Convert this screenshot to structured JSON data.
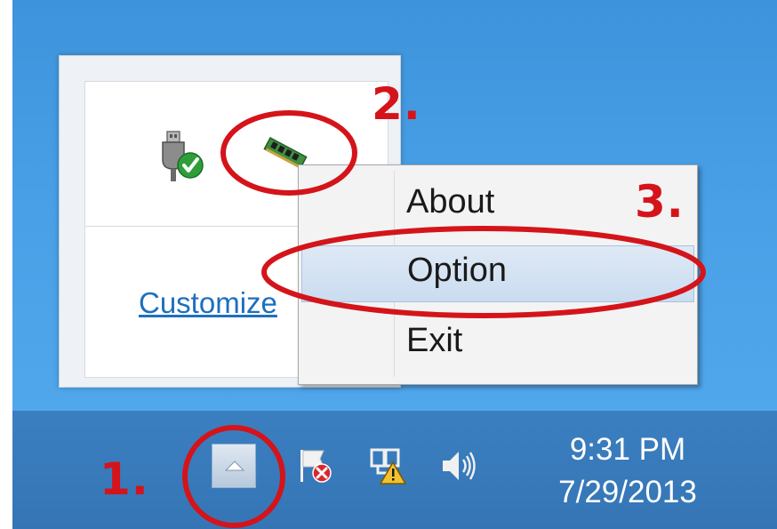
{
  "tray_overflow": {
    "icons": [
      "usb-device-icon",
      "memory-module-icon"
    ],
    "customize_link": "Customize"
  },
  "context_menu": {
    "items": [
      {
        "label": "About"
      },
      {
        "label": "Option",
        "highlighted": true
      },
      {
        "label": "Exit"
      }
    ]
  },
  "taskbar": {
    "show_hidden_icon": "up-arrow-icon",
    "tray_icons": [
      "action-center-flag-icon",
      "network-warning-icon",
      "speaker-icon"
    ],
    "clock": {
      "time": "9:31 PM",
      "date": "7/29/2013"
    }
  },
  "annotations": {
    "step1": "1.",
    "step2": "2.",
    "step3": "3."
  },
  "colors": {
    "annotation_red": "#d4141a",
    "desktop_blue": "#4aa0e6",
    "taskbar_blue": "#3879ba",
    "menu_highlight": "#cadcf0",
    "link_blue": "#1e6fbf"
  }
}
